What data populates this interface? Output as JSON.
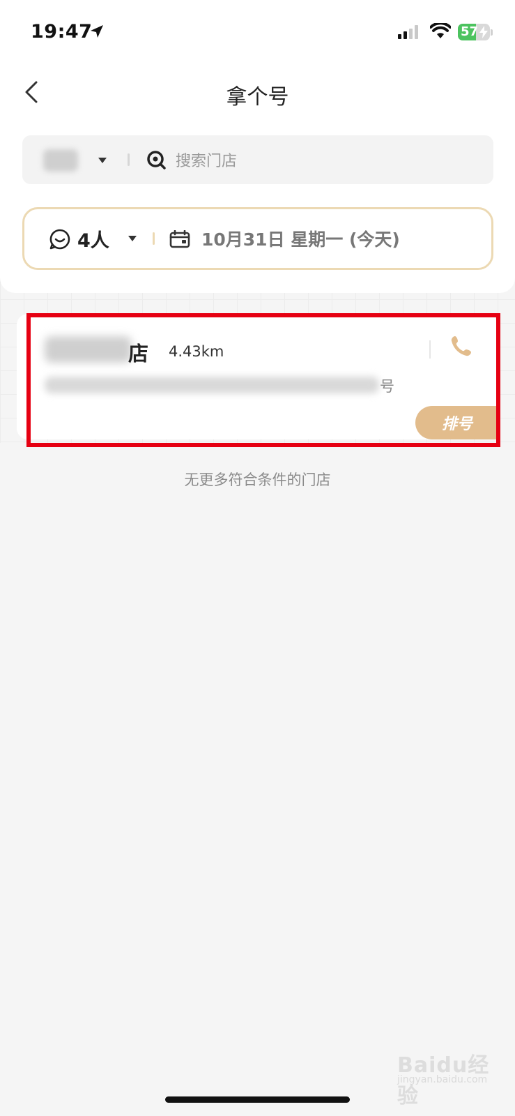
{
  "status_bar": {
    "time": "19:47",
    "battery": "57",
    "battery_level": 0.57,
    "icons": [
      "location-arrow-icon",
      "signal-icon",
      "wifi-icon",
      "battery-icon"
    ]
  },
  "nav": {
    "title": "拿个号",
    "back_icon": "chevron-left-icon"
  },
  "search": {
    "placeholder": "搜索门店",
    "city_icon": "caret-down-icon",
    "search_icon": "search-icon"
  },
  "filters": {
    "people": "4人",
    "date": "10月31日 星期一 (今天)",
    "people_icon": "chat-face-icon",
    "calendar_icon": "calendar-icon"
  },
  "store": {
    "name_suffix": "店",
    "distance": "4.43km",
    "address_suffix": "号",
    "queue_label": "排号",
    "phone_icon": "phone-icon"
  },
  "list_footer": "无更多符合条件的门店",
  "watermark": {
    "brand": "Baidu经验",
    "url": "jingyan.baidu.com"
  },
  "colors": {
    "accent": "#e2bc8c",
    "filter_border": "#ecd9b3",
    "highlight": "#e60012",
    "battery": "#4cc35f"
  }
}
